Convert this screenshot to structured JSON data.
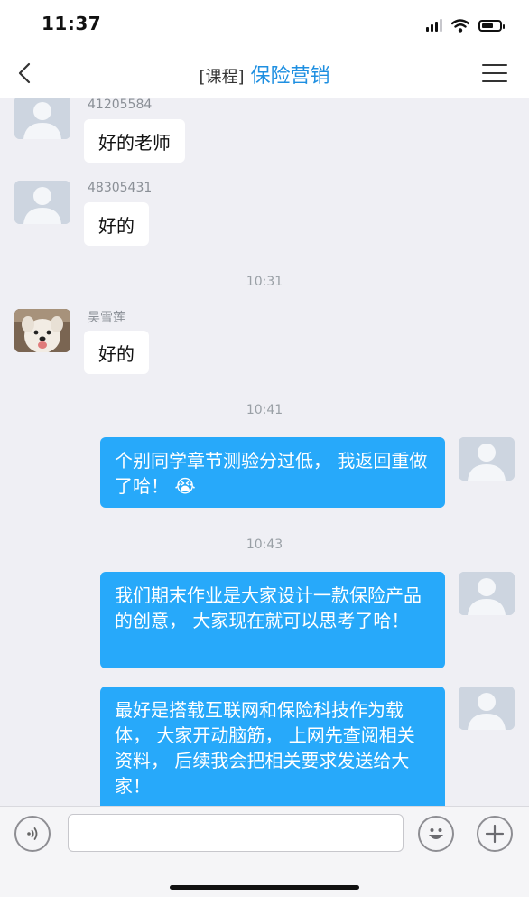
{
  "status_bar": {
    "time": "11:37"
  },
  "header": {
    "title_prefix": "[课程]",
    "title": "保险营销"
  },
  "messages": {
    "m1": {
      "sender": "41205584",
      "text": "好的老师"
    },
    "m2": {
      "sender": "48305431",
      "text": "好的"
    },
    "t1": "10:31",
    "m3": {
      "sender": "吴雪莲",
      "text": "好的"
    },
    "t2": "10:41",
    "m4": {
      "text": "个别同学章节测验分过低， 我返回重做了哈！ 😭"
    },
    "t3": "10:43",
    "m5": {
      "text": "我们期末作业是大家设计一款保险产品的创意， 大家现在就可以思考了哈！"
    },
    "m6": {
      "text": "最好是搭载互联网和保险科技作为载体， 大家开动脑筋， 上网先查阅相关资料， 后续我会把相关要求发送给大家！"
    }
  },
  "input_bar": {
    "placeholder": ""
  },
  "colors": {
    "accent": "#1e8fe1",
    "outgoing_bubble": "#27a9fa",
    "chat_background": "#efeff4"
  },
  "icons": [
    "back-icon",
    "menu-icon",
    "voice-icon",
    "emoji-icon",
    "plus-icon",
    "signal-icon",
    "wifi-icon",
    "battery-icon"
  ]
}
